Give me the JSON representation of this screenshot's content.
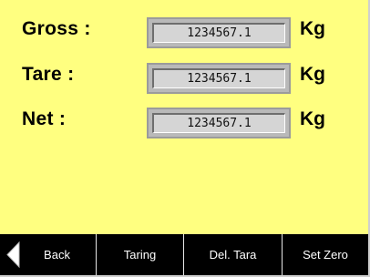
{
  "fields": [
    {
      "label": "Gross :",
      "value": "1234567.1",
      "unit": "Kg"
    },
    {
      "label": "Tare :",
      "value": "1234567.1",
      "unit": "Kg"
    },
    {
      "label": "Net :",
      "value": "1234567.1",
      "unit": "Kg"
    }
  ],
  "softkeys": {
    "back": "Back",
    "taring": "Taring",
    "del_tara": "Del. Tara",
    "set_zero": "Set Zero"
  },
  "icons": {
    "back": "back-arrow-icon"
  },
  "colors": {
    "background": "#ffff80",
    "softkey_bar": "#000000",
    "value_box": "#d5d5d5"
  }
}
